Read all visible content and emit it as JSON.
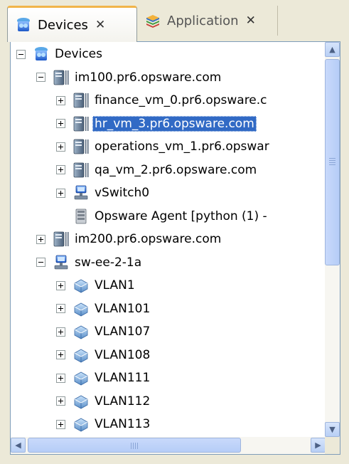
{
  "tabs": [
    {
      "label": "Devices",
      "close": "✕",
      "icon": "devices-icon",
      "active": true
    },
    {
      "label": "Application",
      "close": "✕",
      "icon": "application-icon",
      "active": false
    }
  ],
  "tree": {
    "items": [
      {
        "label": "Devices",
        "expander": "minus",
        "icon": "devices-icon"
      },
      {
        "label": "im100.pr6.opsware.com",
        "expander": "minus",
        "icon": "server-icon"
      },
      {
        "label": "finance_vm_0.pr6.opsware.c",
        "expander": "plus",
        "icon": "server-icon"
      },
      {
        "label": "hr_vm_3.pr6.opsware.com",
        "expander": "plus",
        "icon": "server-icon",
        "selected": true
      },
      {
        "label": "operations_vm_1.pr6.opswar",
        "expander": "plus",
        "icon": "server-icon"
      },
      {
        "label": "qa_vm_2.pr6.opsware.com",
        "expander": "plus",
        "icon": "server-icon"
      },
      {
        "label": "vSwitch0",
        "expander": "plus",
        "icon": "switch-icon"
      },
      {
        "label": "Opsware Agent [python (1) -",
        "expander": "none",
        "icon": "agent-icon"
      },
      {
        "label": "im200.pr6.opsware.com",
        "expander": "plus",
        "icon": "server-icon"
      },
      {
        "label": "sw-ee-2-1a",
        "expander": "minus",
        "icon": "switch-icon"
      },
      {
        "label": "VLAN1",
        "expander": "plus",
        "icon": "vlan-icon"
      },
      {
        "label": "VLAN101",
        "expander": "plus",
        "icon": "vlan-icon"
      },
      {
        "label": "VLAN107",
        "expander": "plus",
        "icon": "vlan-icon"
      },
      {
        "label": "VLAN108",
        "expander": "plus",
        "icon": "vlan-icon"
      },
      {
        "label": "VLAN111",
        "expander": "plus",
        "icon": "vlan-icon"
      },
      {
        "label": "VLAN112",
        "expander": "plus",
        "icon": "vlan-icon"
      },
      {
        "label": "VLAN113",
        "expander": "plus",
        "icon": "vlan-icon"
      }
    ]
  },
  "scrollbars": {
    "up_arrow": "▲",
    "down_arrow": "▼",
    "left_arrow": "◀",
    "right_arrow": "▶"
  },
  "colors": {
    "selection": "#316ac5",
    "active_tab_accent": "#f1b44a"
  }
}
